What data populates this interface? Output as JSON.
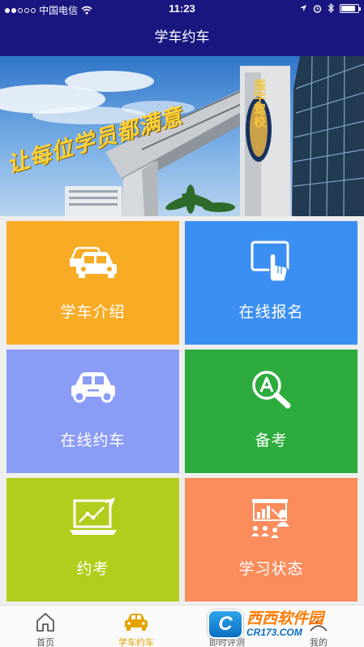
{
  "status_bar": {
    "carrier": "中国电信",
    "time": "11:23",
    "battery_level": 0.85
  },
  "nav": {
    "title": "学车约车"
  },
  "banner": {
    "slogan": "让每位学员都满意",
    "sign": "振宇驾校"
  },
  "tiles": [
    {
      "label": "学车介绍",
      "icon": "cars-icon",
      "color": "#f8ab25"
    },
    {
      "label": "在线报名",
      "icon": "tablet-touch-icon",
      "color": "#3c8ff2"
    },
    {
      "label": "在线约车",
      "icon": "car-icon",
      "color": "#8a9cf5"
    },
    {
      "label": "备考",
      "icon": "search-a-icon",
      "color": "#2dab3d"
    },
    {
      "label": "约考",
      "icon": "laptop-chart-icon",
      "color": "#b3cd1c"
    },
    {
      "label": "学习状态",
      "icon": "presentation-icon",
      "color": "#fb8c5c"
    }
  ],
  "tab_bar": {
    "items": [
      {
        "label": "首页",
        "icon": "home-icon"
      },
      {
        "label": "学车约车",
        "icon": "car-icon",
        "active": true
      },
      {
        "label": "即时评测",
        "icon": "evaluation-icon"
      },
      {
        "label": "我的",
        "icon": "profile-icon"
      }
    ]
  },
  "watermark": {
    "name": "西西软件园",
    "site": "CR173.COM"
  },
  "colors": {
    "nav_bg": "#1a1680",
    "accent": "#e3a400"
  }
}
